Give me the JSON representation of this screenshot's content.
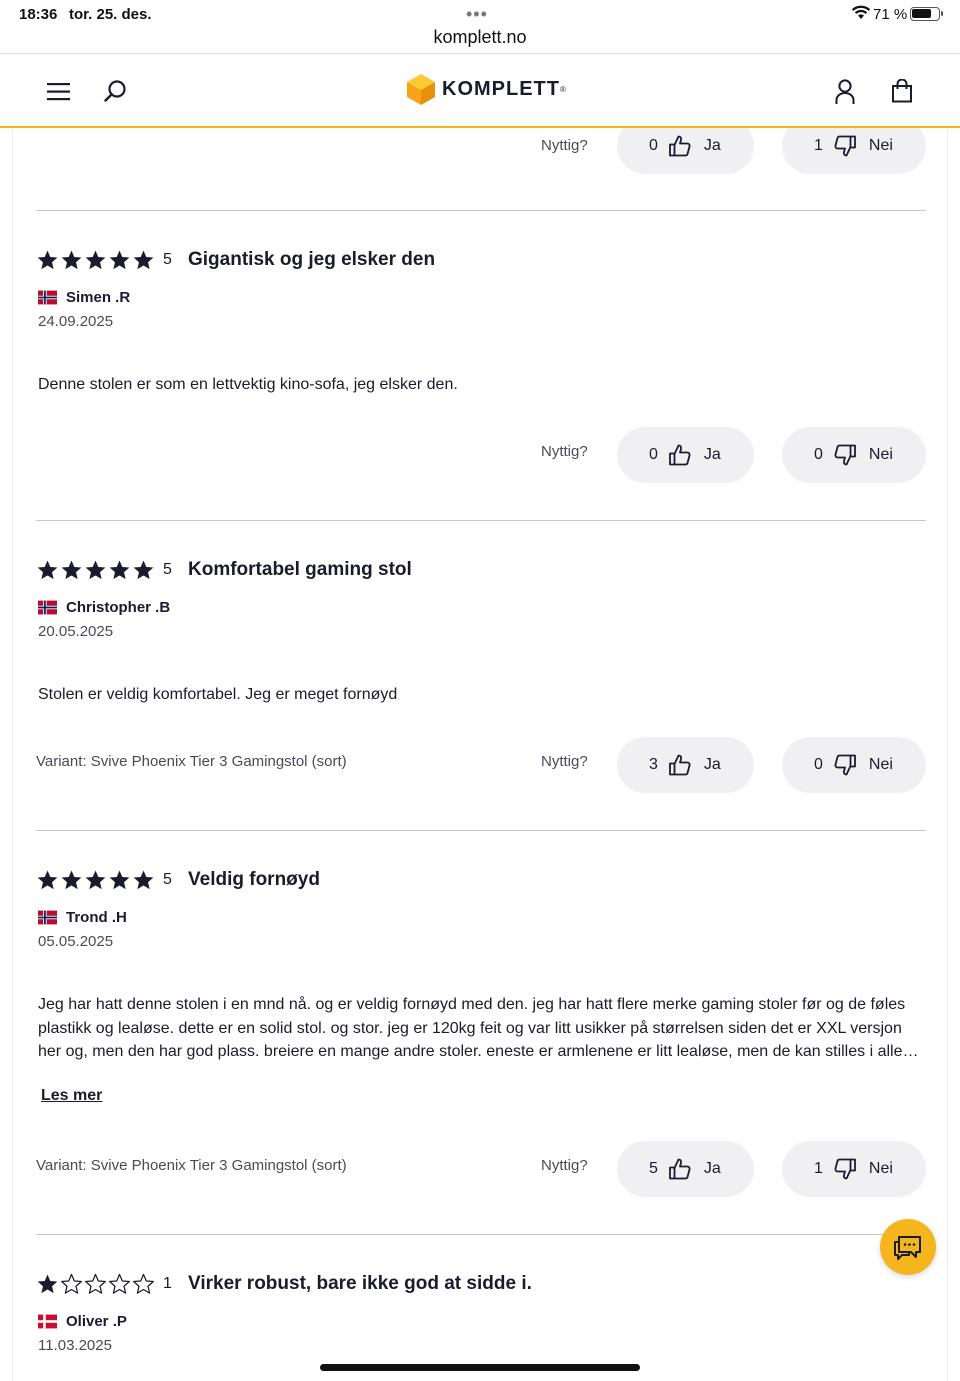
{
  "status_bar": {
    "time": "18:36",
    "date": "tor. 25. des.",
    "battery": "71 %"
  },
  "browser": {
    "url": "komplett.no"
  },
  "header": {
    "logo_text": "KOMPLETT"
  },
  "labels": {
    "helpful": "Nyttig?",
    "yes": "Ja",
    "no": "Nei",
    "read_more": "Les mer"
  },
  "partial_review": {
    "yes_count": "0",
    "no_count": "1"
  },
  "reviews": [
    {
      "rating": 5,
      "rating_text": "5",
      "title": "Gigantisk og jeg elsker den",
      "author": "Simen .R",
      "date": "24.09.2025",
      "body": "Denne stolen er som en lettvektig kino-sofa, jeg elsker den.",
      "variant": "",
      "yes_count": "0",
      "no_count": "0"
    },
    {
      "rating": 5,
      "rating_text": "5",
      "title": "Komfortabel gaming stol",
      "author": "Christopher .B",
      "date": "20.05.2025",
      "body": "Stolen er veldig komfortabel. Jeg er meget fornøyd",
      "variant": "Variant: Svive Phoenix Tier 3 Gamingstol (sort)",
      "yes_count": "3",
      "no_count": "0"
    },
    {
      "rating": 5,
      "rating_text": "5",
      "title": "Veldig fornøyd",
      "author": "Trond .H",
      "date": "05.05.2025",
      "body_lines": [
        "Jeg har hatt denne stolen i en mnd nå. og er veldig fornøyd med den. jeg har hatt flere merke gaming stoler før og de føles",
        "plastikk og lealøse. dette er en solid stol. og stor. jeg er 120kg feit og var litt usikker på størrelsen siden det er XXL versjon",
        "her og, men den har god plass. breiere en mange andre stoler. eneste er armlenene er litt lealøse, men de kan stilles i alle…"
      ],
      "variant": "Variant: Svive Phoenix Tier 3 Gamingstol (sort)",
      "yes_count": "5",
      "no_count": "1"
    },
    {
      "rating": 1,
      "rating_text": "1",
      "title": "Virker robust, bare ikke god at sidde i.",
      "author": "Oliver .P",
      "date": "11.03.2025"
    }
  ],
  "colors": {
    "accent": "#f5b51e",
    "text": "#1b1b2e",
    "vote_bg": "#f0f0f2"
  },
  "icons": [
    "menu-icon",
    "search-icon",
    "user-icon",
    "cart-icon",
    "thumbs-up-icon",
    "thumbs-down-icon",
    "chat-icon",
    "star-icon",
    "flag-icon"
  ]
}
